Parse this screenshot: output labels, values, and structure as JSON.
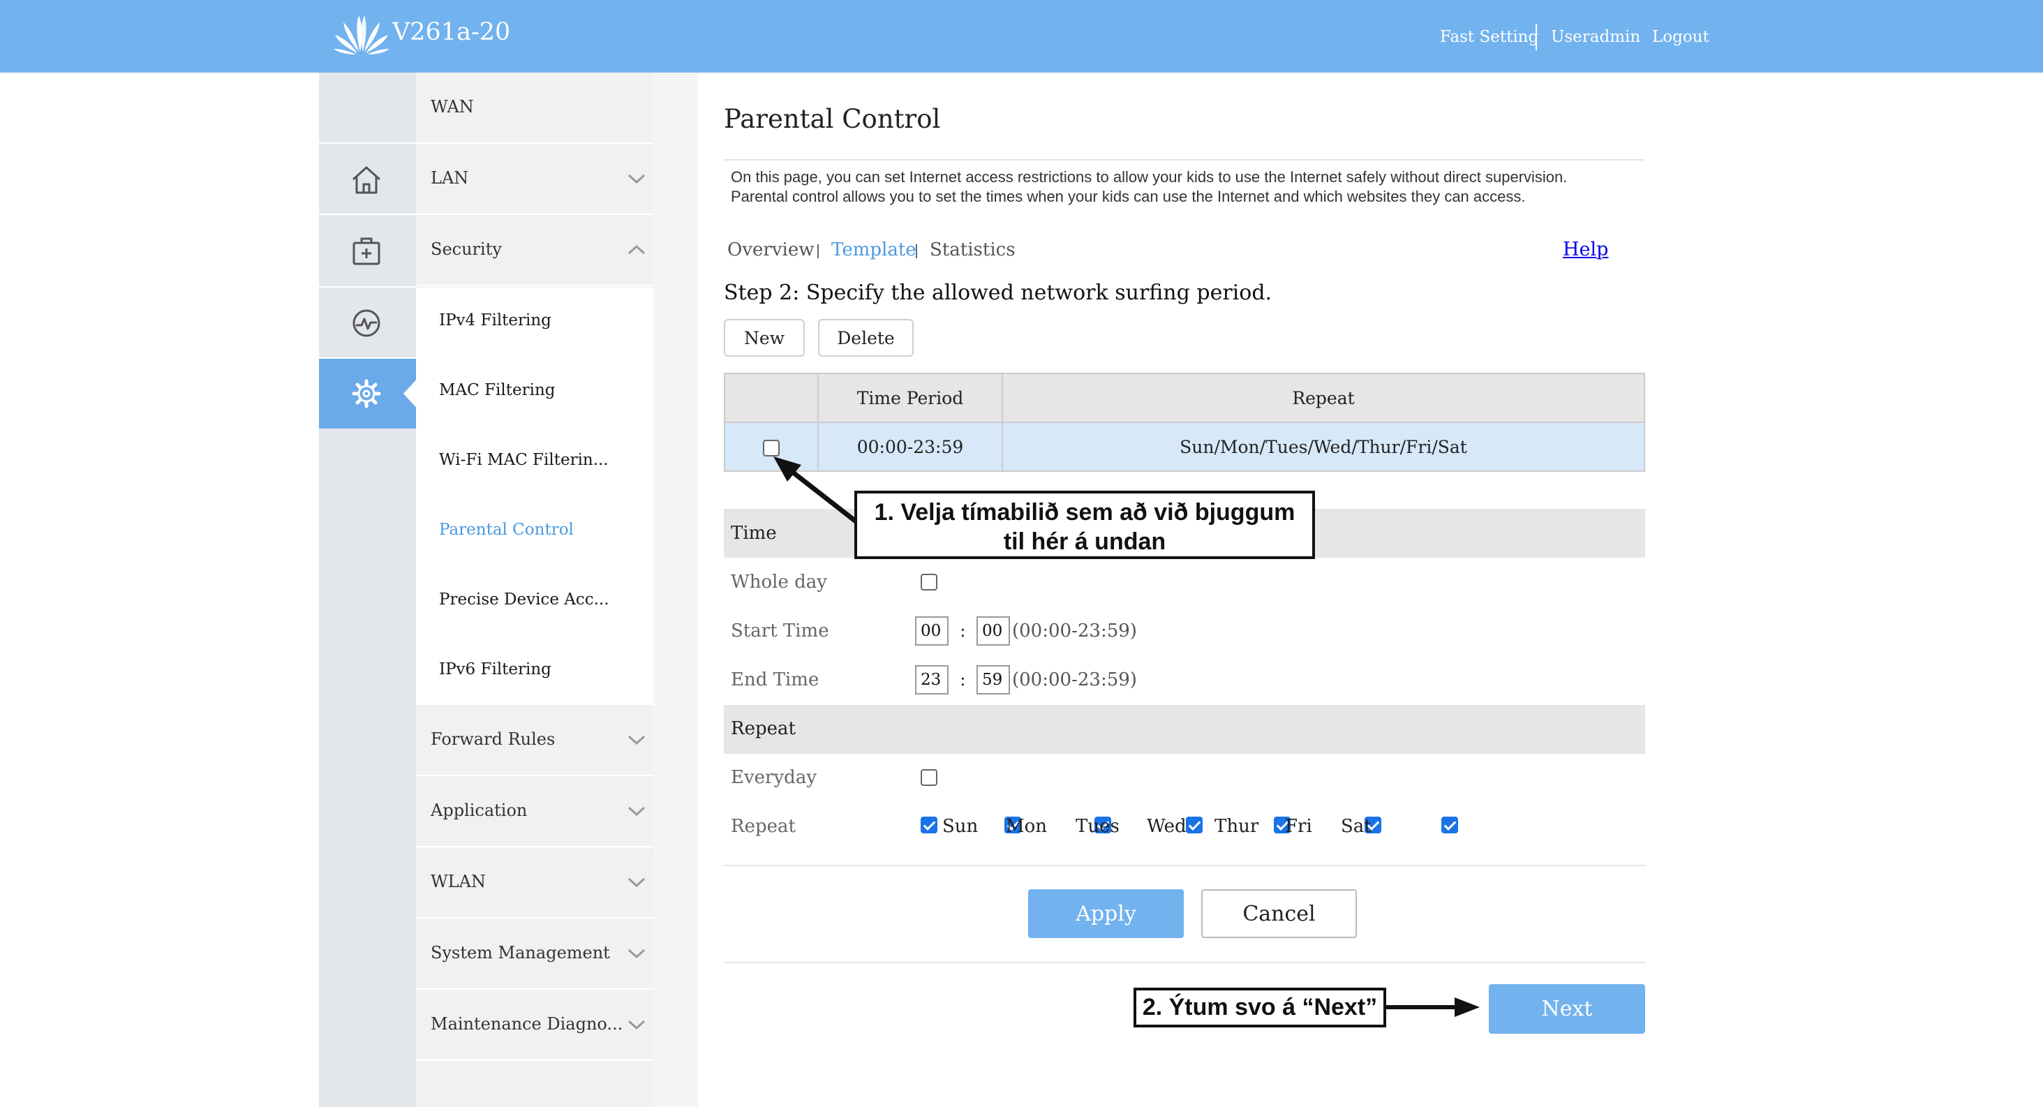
{
  "header": {
    "device_name": "V261a-20",
    "links": {
      "fast_setting": "Fast Setting",
      "user": "Useradmin",
      "logout": "Logout"
    }
  },
  "menu": {
    "wan": "WAN",
    "lan": "LAN",
    "security": "Security",
    "security_items": [
      "IPv4 Filtering",
      "MAC Filtering",
      "Wi-Fi MAC Filterin...",
      "Parental Control",
      "Precise Device Acc...",
      "IPv6 Filtering"
    ],
    "forward_rules": "Forward Rules",
    "application": "Application",
    "wlan": "WLAN",
    "system_management": "System Management",
    "maintenance": "Maintenance Diagno..."
  },
  "page": {
    "title": "Parental Control",
    "description_line1": "On this page, you can set Internet access restrictions to allow your kids to use the Internet safely without direct supervision.",
    "description_line2": "Parental control allows you to set the times when your kids can use the Internet and which websites they can access.",
    "tabs": {
      "overview": "Overview",
      "template": "Template",
      "statistics": "Statistics"
    },
    "help": "Help",
    "step": "Step 2: Specify the allowed network surfing period.",
    "buttons": {
      "new": "New",
      "delete": "Delete",
      "apply": "Apply",
      "cancel": "Cancel",
      "next": "Next"
    }
  },
  "table": {
    "headers": {
      "time_period": "Time Period",
      "repeat": "Repeat"
    },
    "rows": [
      {
        "time_period": "00:00-23:59",
        "repeat": "Sun/Mon/Tues/Wed/Thur/Fri/Sat",
        "checked": false
      }
    ]
  },
  "form": {
    "time_section": "Time",
    "whole_day": "Whole day",
    "start_time": {
      "label": "Start Time",
      "hour": "00",
      "minute": "00",
      "range": "(00:00-23:59)"
    },
    "end_time": {
      "label": "End Time",
      "hour": "23",
      "minute": "59",
      "range": "(00:00-23:59)"
    },
    "repeat_section": "Repeat",
    "everyday": "Everyday",
    "repeat_label": "Repeat",
    "days": [
      "Sun",
      "Mon",
      "Tues",
      "Wed",
      "Thur",
      "Fri",
      "Sat"
    ],
    "colon": ":"
  },
  "annotations": {
    "callout1_line1": "1. Velja tímabilið sem að við bjuggum",
    "callout1_line2": "til hér á undan",
    "callout2": "2. Ýtum svo á “Next”"
  },
  "colors": {
    "header": "#72b2ee",
    "accent": "#4a9ae0",
    "rail_active": "#6aaaea",
    "selected_row": "#d7e8f9"
  }
}
